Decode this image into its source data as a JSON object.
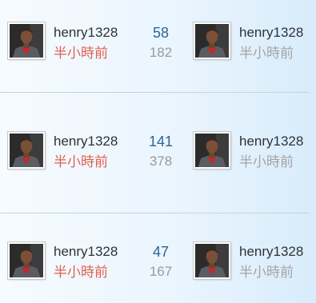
{
  "colors": {
    "username": "#2e3238",
    "time_author": "#e0604f",
    "time_last": "#a4a4a4",
    "reply_count": "#2f6396",
    "view_count": "#9a9a9a",
    "divider": "#c9d2da"
  },
  "rows": [
    {
      "author": {
        "avatar_icon": "user-avatar-icon",
        "name": "henry1328",
        "time": "半小時前"
      },
      "stats": {
        "replies": "58",
        "views": "182"
      },
      "last_post": {
        "avatar_icon": "user-avatar-icon",
        "name": "henry1328",
        "time": "半小時前"
      }
    },
    {
      "author": {
        "avatar_icon": "user-avatar-icon",
        "name": "henry1328",
        "time": "半小時前"
      },
      "stats": {
        "replies": "141",
        "views": "378"
      },
      "last_post": {
        "avatar_icon": "user-avatar-icon",
        "name": "henry1328",
        "time": "半小時前"
      }
    },
    {
      "author": {
        "avatar_icon": "user-avatar-icon",
        "name": "henry1328",
        "time": "半小時前"
      },
      "stats": {
        "replies": "47",
        "views": "167"
      },
      "last_post": {
        "avatar_icon": "user-avatar-icon",
        "name": "henry1328",
        "time": "半小時前"
      }
    }
  ]
}
